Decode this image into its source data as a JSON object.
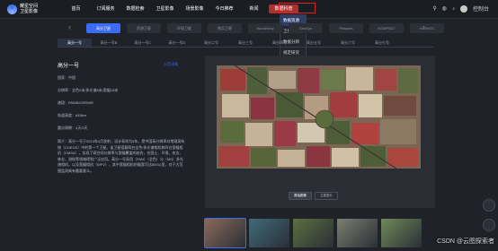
{
  "brand": {
    "line1": "耀星空间",
    "line2": "卫星影像"
  },
  "nav": [
    {
      "label": "首页",
      "active": false
    },
    {
      "label": "订阅服务",
      "active": false
    },
    {
      "label": "数据检索",
      "active": false
    },
    {
      "label": "卫星影像",
      "active": false
    },
    {
      "label": "场景影像",
      "active": false
    },
    {
      "label": "今日推荐",
      "active": false
    },
    {
      "label": "新闻",
      "active": false
    },
    {
      "label": "数据科普",
      "active": true
    }
  ],
  "dropdown": [
    "数据资源",
    "卫星星座",
    "数据分辨",
    "规定研究"
  ],
  "header_right": {
    "icon1": "location-icon",
    "icon2": "globe-icon",
    "icon3": "bell-icon",
    "user_label": "控制台"
  },
  "chips": [
    "高分卫星",
    "资源卫星",
    "环境卫星",
    "哨兵卫星",
    "WorldView",
    "GeoEye",
    "Pleiades",
    "KOMPSAT",
    "IKONOS"
  ],
  "sat_tabs": [
    "高分一号",
    "高分一号B",
    "高分一号C",
    "高分一号D",
    "高分二号",
    "高分三号",
    "高分四号",
    "高分五号",
    "高分六号",
    "高分七号"
  ],
  "panel": {
    "title": "高分一号",
    "link": "示范详情",
    "lines": [
      "国家：中国",
      "分辨率：全色2米/多光谱8米/宽幅16米",
      "谱段：PAN/B/G/R/NIR",
      "轨道高度：645km",
      "重访周期：4天/2天"
    ],
    "description": "简介：高分一号于2013年4月发射，设计寿命为5年。是中国高分辨率对地观测系统（CHEOS）中的第一个卫星。该卫星搭载两台全色/多光谱相机和四台宽幅相机（CMSA），实现了高空间分辨率与宽幅覆盖的结合，在国土、环境、农业、林业、测绘等领域得到广泛应用。高分一号采用（PAN）（全色）与（MS）多光谱相机，以及宽幅相机（WFV），其中宽幅相机的幅宽可达800公里，对于大范围监测具有重要意义。"
  },
  "viewer": {
    "btn1": "原始图像",
    "btn2": "卫星图片"
  },
  "thumb_colors": [
    "#8a6a5c",
    "#3f6b7a",
    "#5b7040",
    "#7b8070",
    "#6e8a5a"
  ],
  "watermark": "CSDN @云图探索者"
}
